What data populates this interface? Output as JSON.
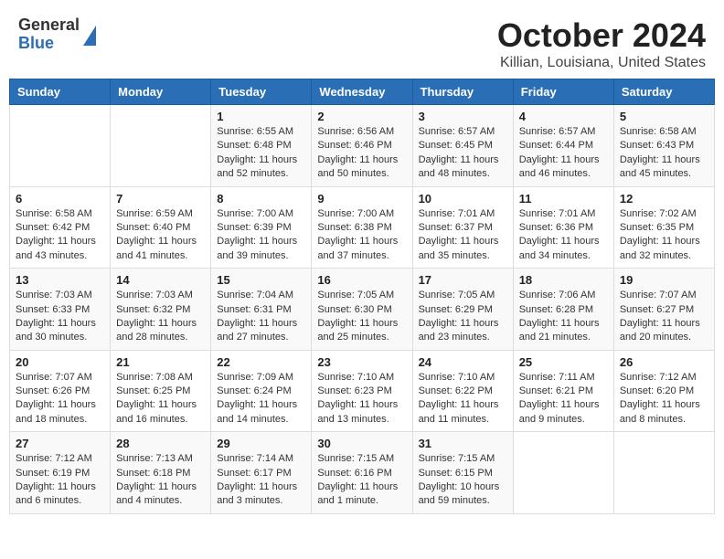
{
  "header": {
    "logo": {
      "general": "General",
      "blue": "Blue"
    },
    "title": "October 2024",
    "subtitle": "Killian, Louisiana, United States"
  },
  "days_of_week": [
    "Sunday",
    "Monday",
    "Tuesday",
    "Wednesday",
    "Thursday",
    "Friday",
    "Saturday"
  ],
  "weeks": [
    [
      {
        "day": "",
        "sunrise": "",
        "sunset": "",
        "daylight": ""
      },
      {
        "day": "",
        "sunrise": "",
        "sunset": "",
        "daylight": ""
      },
      {
        "day": "1",
        "sunrise": "Sunrise: 6:55 AM",
        "sunset": "Sunset: 6:48 PM",
        "daylight": "Daylight: 11 hours and 52 minutes."
      },
      {
        "day": "2",
        "sunrise": "Sunrise: 6:56 AM",
        "sunset": "Sunset: 6:46 PM",
        "daylight": "Daylight: 11 hours and 50 minutes."
      },
      {
        "day": "3",
        "sunrise": "Sunrise: 6:57 AM",
        "sunset": "Sunset: 6:45 PM",
        "daylight": "Daylight: 11 hours and 48 minutes."
      },
      {
        "day": "4",
        "sunrise": "Sunrise: 6:57 AM",
        "sunset": "Sunset: 6:44 PM",
        "daylight": "Daylight: 11 hours and 46 minutes."
      },
      {
        "day": "5",
        "sunrise": "Sunrise: 6:58 AM",
        "sunset": "Sunset: 6:43 PM",
        "daylight": "Daylight: 11 hours and 45 minutes."
      }
    ],
    [
      {
        "day": "6",
        "sunrise": "Sunrise: 6:58 AM",
        "sunset": "Sunset: 6:42 PM",
        "daylight": "Daylight: 11 hours and 43 minutes."
      },
      {
        "day": "7",
        "sunrise": "Sunrise: 6:59 AM",
        "sunset": "Sunset: 6:40 PM",
        "daylight": "Daylight: 11 hours and 41 minutes."
      },
      {
        "day": "8",
        "sunrise": "Sunrise: 7:00 AM",
        "sunset": "Sunset: 6:39 PM",
        "daylight": "Daylight: 11 hours and 39 minutes."
      },
      {
        "day": "9",
        "sunrise": "Sunrise: 7:00 AM",
        "sunset": "Sunset: 6:38 PM",
        "daylight": "Daylight: 11 hours and 37 minutes."
      },
      {
        "day": "10",
        "sunrise": "Sunrise: 7:01 AM",
        "sunset": "Sunset: 6:37 PM",
        "daylight": "Daylight: 11 hours and 35 minutes."
      },
      {
        "day": "11",
        "sunrise": "Sunrise: 7:01 AM",
        "sunset": "Sunset: 6:36 PM",
        "daylight": "Daylight: 11 hours and 34 minutes."
      },
      {
        "day": "12",
        "sunrise": "Sunrise: 7:02 AM",
        "sunset": "Sunset: 6:35 PM",
        "daylight": "Daylight: 11 hours and 32 minutes."
      }
    ],
    [
      {
        "day": "13",
        "sunrise": "Sunrise: 7:03 AM",
        "sunset": "Sunset: 6:33 PM",
        "daylight": "Daylight: 11 hours and 30 minutes."
      },
      {
        "day": "14",
        "sunrise": "Sunrise: 7:03 AM",
        "sunset": "Sunset: 6:32 PM",
        "daylight": "Daylight: 11 hours and 28 minutes."
      },
      {
        "day": "15",
        "sunrise": "Sunrise: 7:04 AM",
        "sunset": "Sunset: 6:31 PM",
        "daylight": "Daylight: 11 hours and 27 minutes."
      },
      {
        "day": "16",
        "sunrise": "Sunrise: 7:05 AM",
        "sunset": "Sunset: 6:30 PM",
        "daylight": "Daylight: 11 hours and 25 minutes."
      },
      {
        "day": "17",
        "sunrise": "Sunrise: 7:05 AM",
        "sunset": "Sunset: 6:29 PM",
        "daylight": "Daylight: 11 hours and 23 minutes."
      },
      {
        "day": "18",
        "sunrise": "Sunrise: 7:06 AM",
        "sunset": "Sunset: 6:28 PM",
        "daylight": "Daylight: 11 hours and 21 minutes."
      },
      {
        "day": "19",
        "sunrise": "Sunrise: 7:07 AM",
        "sunset": "Sunset: 6:27 PM",
        "daylight": "Daylight: 11 hours and 20 minutes."
      }
    ],
    [
      {
        "day": "20",
        "sunrise": "Sunrise: 7:07 AM",
        "sunset": "Sunset: 6:26 PM",
        "daylight": "Daylight: 11 hours and 18 minutes."
      },
      {
        "day": "21",
        "sunrise": "Sunrise: 7:08 AM",
        "sunset": "Sunset: 6:25 PM",
        "daylight": "Daylight: 11 hours and 16 minutes."
      },
      {
        "day": "22",
        "sunrise": "Sunrise: 7:09 AM",
        "sunset": "Sunset: 6:24 PM",
        "daylight": "Daylight: 11 hours and 14 minutes."
      },
      {
        "day": "23",
        "sunrise": "Sunrise: 7:10 AM",
        "sunset": "Sunset: 6:23 PM",
        "daylight": "Daylight: 11 hours and 13 minutes."
      },
      {
        "day": "24",
        "sunrise": "Sunrise: 7:10 AM",
        "sunset": "Sunset: 6:22 PM",
        "daylight": "Daylight: 11 hours and 11 minutes."
      },
      {
        "day": "25",
        "sunrise": "Sunrise: 7:11 AM",
        "sunset": "Sunset: 6:21 PM",
        "daylight": "Daylight: 11 hours and 9 minutes."
      },
      {
        "day": "26",
        "sunrise": "Sunrise: 7:12 AM",
        "sunset": "Sunset: 6:20 PM",
        "daylight": "Daylight: 11 hours and 8 minutes."
      }
    ],
    [
      {
        "day": "27",
        "sunrise": "Sunrise: 7:12 AM",
        "sunset": "Sunset: 6:19 PM",
        "daylight": "Daylight: 11 hours and 6 minutes."
      },
      {
        "day": "28",
        "sunrise": "Sunrise: 7:13 AM",
        "sunset": "Sunset: 6:18 PM",
        "daylight": "Daylight: 11 hours and 4 minutes."
      },
      {
        "day": "29",
        "sunrise": "Sunrise: 7:14 AM",
        "sunset": "Sunset: 6:17 PM",
        "daylight": "Daylight: 11 hours and 3 minutes."
      },
      {
        "day": "30",
        "sunrise": "Sunrise: 7:15 AM",
        "sunset": "Sunset: 6:16 PM",
        "daylight": "Daylight: 11 hours and 1 minute."
      },
      {
        "day": "31",
        "sunrise": "Sunrise: 7:15 AM",
        "sunset": "Sunset: 6:15 PM",
        "daylight": "Daylight: 10 hours and 59 minutes."
      },
      {
        "day": "",
        "sunrise": "",
        "sunset": "",
        "daylight": ""
      },
      {
        "day": "",
        "sunrise": "",
        "sunset": "",
        "daylight": ""
      }
    ]
  ]
}
